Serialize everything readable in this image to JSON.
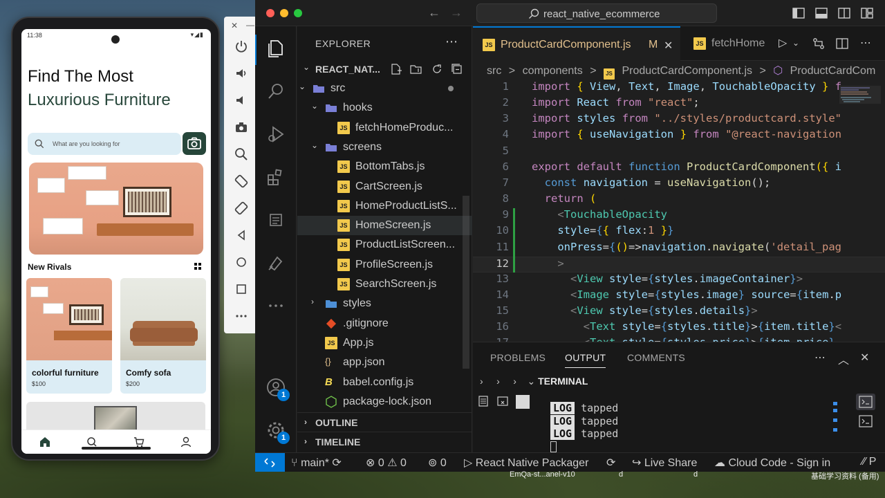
{
  "phone": {
    "status_time": "11:38",
    "title_line1": "Find The Most",
    "title_line2": "Luxurious Furniture",
    "search_placeholder": "What are you looking for",
    "section_title": "New Rivals",
    "products": [
      {
        "title": "colorful furniture",
        "price": "$100"
      },
      {
        "title": "Comfy sofa",
        "price": "$200"
      }
    ]
  },
  "vscode": {
    "search_text": "react_native_ecommerce",
    "explorer_title": "EXPLORER",
    "project": "REACT_NAT...",
    "tree": [
      {
        "label": "src",
        "type": "folder-open",
        "depth": 1
      },
      {
        "label": "hooks",
        "type": "folder-open",
        "depth": 2
      },
      {
        "label": "fetchHomeProduc...",
        "type": "js",
        "depth": 3
      },
      {
        "label": "screens",
        "type": "folder-open",
        "depth": 2
      },
      {
        "label": "BottomTabs.js",
        "type": "js",
        "depth": 3
      },
      {
        "label": "CartScreen.js",
        "type": "js",
        "depth": 3
      },
      {
        "label": "HomeProductListS...",
        "type": "js",
        "depth": 3
      },
      {
        "label": "HomeScreen.js",
        "type": "js",
        "depth": 3
      },
      {
        "label": "ProductListScreen...",
        "type": "js",
        "depth": 3
      },
      {
        "label": "ProfileScreen.js",
        "type": "js",
        "depth": 3
      },
      {
        "label": "SearchScreen.js",
        "type": "js",
        "depth": 3
      },
      {
        "label": "styles",
        "type": "folder",
        "depth": 2
      },
      {
        "label": ".gitignore",
        "type": "git",
        "depth": 2
      },
      {
        "label": "App.js",
        "type": "js",
        "depth": 2
      },
      {
        "label": "app.json",
        "type": "json",
        "depth": 2
      },
      {
        "label": "babel.config.js",
        "type": "babel",
        "depth": 2
      },
      {
        "label": "package-lock.json",
        "type": "json2",
        "depth": 2
      }
    ],
    "outline_label": "OUTLINE",
    "timeline_label": "TIMELINE",
    "tabs": [
      {
        "label": "ProductCardComponent.js",
        "modified": "M",
        "close": "✕"
      },
      {
        "label": "fetchHome"
      }
    ],
    "breadcrumb": [
      "src",
      ">",
      "components",
      ">",
      "ProductCardComponent.js",
      ">",
      "ProductCardCom"
    ],
    "code_lines": [
      {
        "n": "1",
        "html": "<span class='k'>import</span> <span class='y'>{</span> <span class='v'>View</span>, <span class='v'>Text</span>, <span class='v'>Image</span>, <span class='v'>TouchableOpacity</span> <span class='y'>}</span> <span class='k'>f</span>"
      },
      {
        "n": "2",
        "html": "<span class='k'>import</span> <span class='v'>React</span> <span class='k'>from</span> <span class='s'>\"react\"</span>;"
      },
      {
        "n": "3",
        "html": "<span class='k'>import</span> <span class='v'>styles</span> <span class='k'>from</span> <span class='s'>\"../styles/productcard.style\"</span>"
      },
      {
        "n": "4",
        "html": "<span class='k'>import</span> <span class='y'>{</span> <span class='v'>useNavigation</span> <span class='y'>}</span> <span class='k'>from</span> <span class='s'>\"@react-navigation</span>"
      },
      {
        "n": "5",
        "html": ""
      },
      {
        "n": "6",
        "html": "<span class='k'>export</span> <span class='k'>default</span> <span class='kb'>function</span> <span class='f'>ProductCardComponent</span><span class='y'>(</span><span class='y'>{</span> <span class='v'>i</span>"
      },
      {
        "n": "7",
        "html": "  <span class='kb'>const</span> <span class='v'>navigation</span> = <span class='f'>useNavigation</span>();"
      },
      {
        "n": "8",
        "html": "  <span class='k'>return</span> <span class='y'>(</span>"
      },
      {
        "n": "9",
        "html": "    <span class='p'>&lt;</span><span class='t'>TouchableOpacity</span>"
      },
      {
        "n": "10",
        "html": "    <span class='v'>style</span>=<span class='kb'>{</span><span class='y'>{</span> <span class='v'>flex</span>:<span class='s'>1</span> <span class='y'>}</span><span class='kb'>}</span>"
      },
      {
        "n": "11",
        "html": "    <span class='v'>onPress</span>=<span class='kb'>{</span><span class='y'>()</span>=&gt;<span class='v'>navigation</span>.<span class='f'>navigate</span>(<span class='s'>'detail_pag</span>"
      },
      {
        "n": "12",
        "html": "    <span class='p'>&gt;</span>"
      },
      {
        "n": "13",
        "html": "      <span class='p'>&lt;</span><span class='t'>View</span> <span class='v'>style</span>=<span class='kb'>{</span><span class='v'>styles</span>.<span class='v'>imageContainer</span><span class='kb'>}</span><span class='p'>&gt;</span>"
      },
      {
        "n": "14",
        "html": "      <span class='p'>&lt;</span><span class='t'>Image</span> <span class='v'>style</span>=<span class='kb'>{</span><span class='v'>styles</span>.<span class='v'>image</span><span class='kb'>}</span> <span class='v'>source</span>=<span class='kb'>{</span><span class='v'>item</span>.<span class='v'>p</span>"
      },
      {
        "n": "15",
        "html": "      <span class='p'>&lt;</span><span class='t'>View</span> <span class='v'>style</span>=<span class='kb'>{</span><span class='v'>styles</span>.<span class='v'>details</span><span class='kb'>}</span><span class='p'>&gt;</span>"
      },
      {
        "n": "16",
        "html": "        <span class='p'>&lt;</span><span class='t'>Text</span> <span class='v'>style</span>=<span class='kb'>{</span><span class='v'>styles</span>.<span class='v'>title</span><span class='kb'>}</span>&gt;<span class='kb'>{</span><span class='v'>item</span>.<span class='v'>title</span><span class='kb'>}</span><span class='p'>&lt;</span>"
      },
      {
        "n": "17",
        "html": "        <span class='p'>&lt;</span><span class='t'>Text</span> <span class='v'>style</span>=<span class='kb'>{</span><span class='v'>styles</span>.<span class='v'>price</span><span class='kb'>}</span>&gt;<span class='kb'>{</span><span class='v'>item</span>.<span class='v'>price</span><span class='kb'>}</span>"
      }
    ],
    "panel_tabs": [
      "PROBLEMS",
      "OUTPUT",
      "COMMENTS"
    ],
    "terminal_label": "TERMINAL",
    "logs": [
      {
        "tag": "LOG",
        "msg": "tapped"
      },
      {
        "tag": "LOG",
        "msg": "tapped"
      },
      {
        "tag": "LOG",
        "msg": "tapped"
      }
    ],
    "status": {
      "branch": "main*",
      "errors": "0",
      "warnings": "0",
      "ports": "0",
      "packager": "React Native Packager",
      "live_share": "Live Share",
      "cloud_code": "Cloud Code - Sign in"
    },
    "badges": {
      "accounts": "1",
      "settings": "1"
    }
  },
  "dock": {
    "item1": "EmQa-st...anel-v10",
    "item2": "d",
    "item3": "d",
    "item4": "基础学习资料 (备用)"
  },
  "colors": {
    "accent": "#0078d4",
    "app_green": "#26463a",
    "search_bg": "#dcedf5"
  }
}
